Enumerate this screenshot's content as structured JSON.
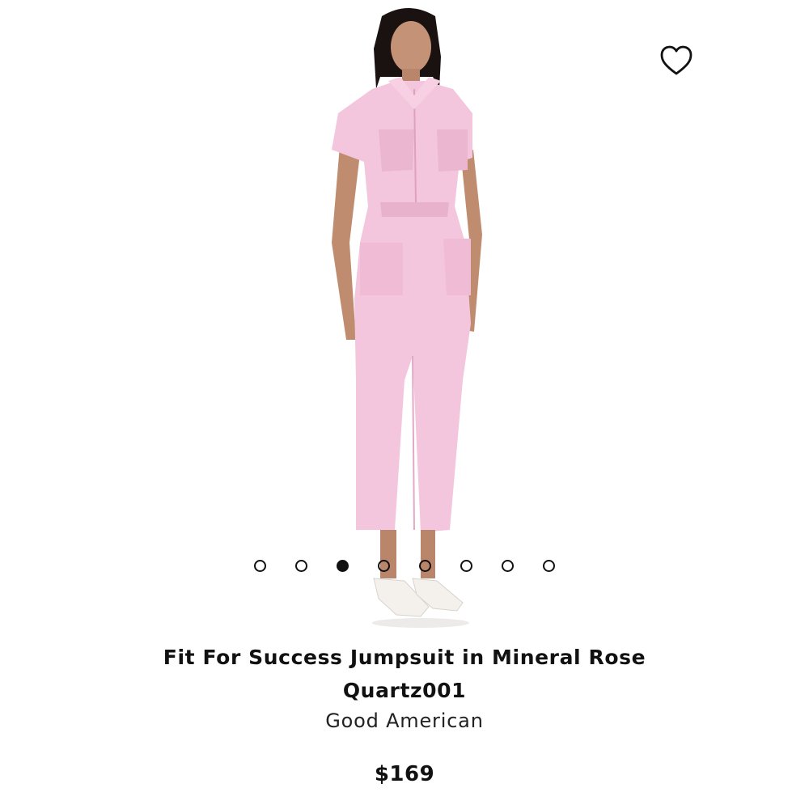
{
  "product": {
    "title_line1": "Fit For Success Jumpsuit in Mineral Rose",
    "title_line2": "Quartz001",
    "brand": "Good American",
    "price": "$169"
  },
  "gallery": {
    "image_description_icon": "model-in-pink-jumpsuit-photo",
    "dot_count": 8,
    "active_index": 2
  },
  "icons": {
    "wishlist": "heart-outline-icon"
  },
  "colors": {
    "jumpsuit": "#f4c6dd",
    "dot": "#111111",
    "text": "#111111"
  }
}
